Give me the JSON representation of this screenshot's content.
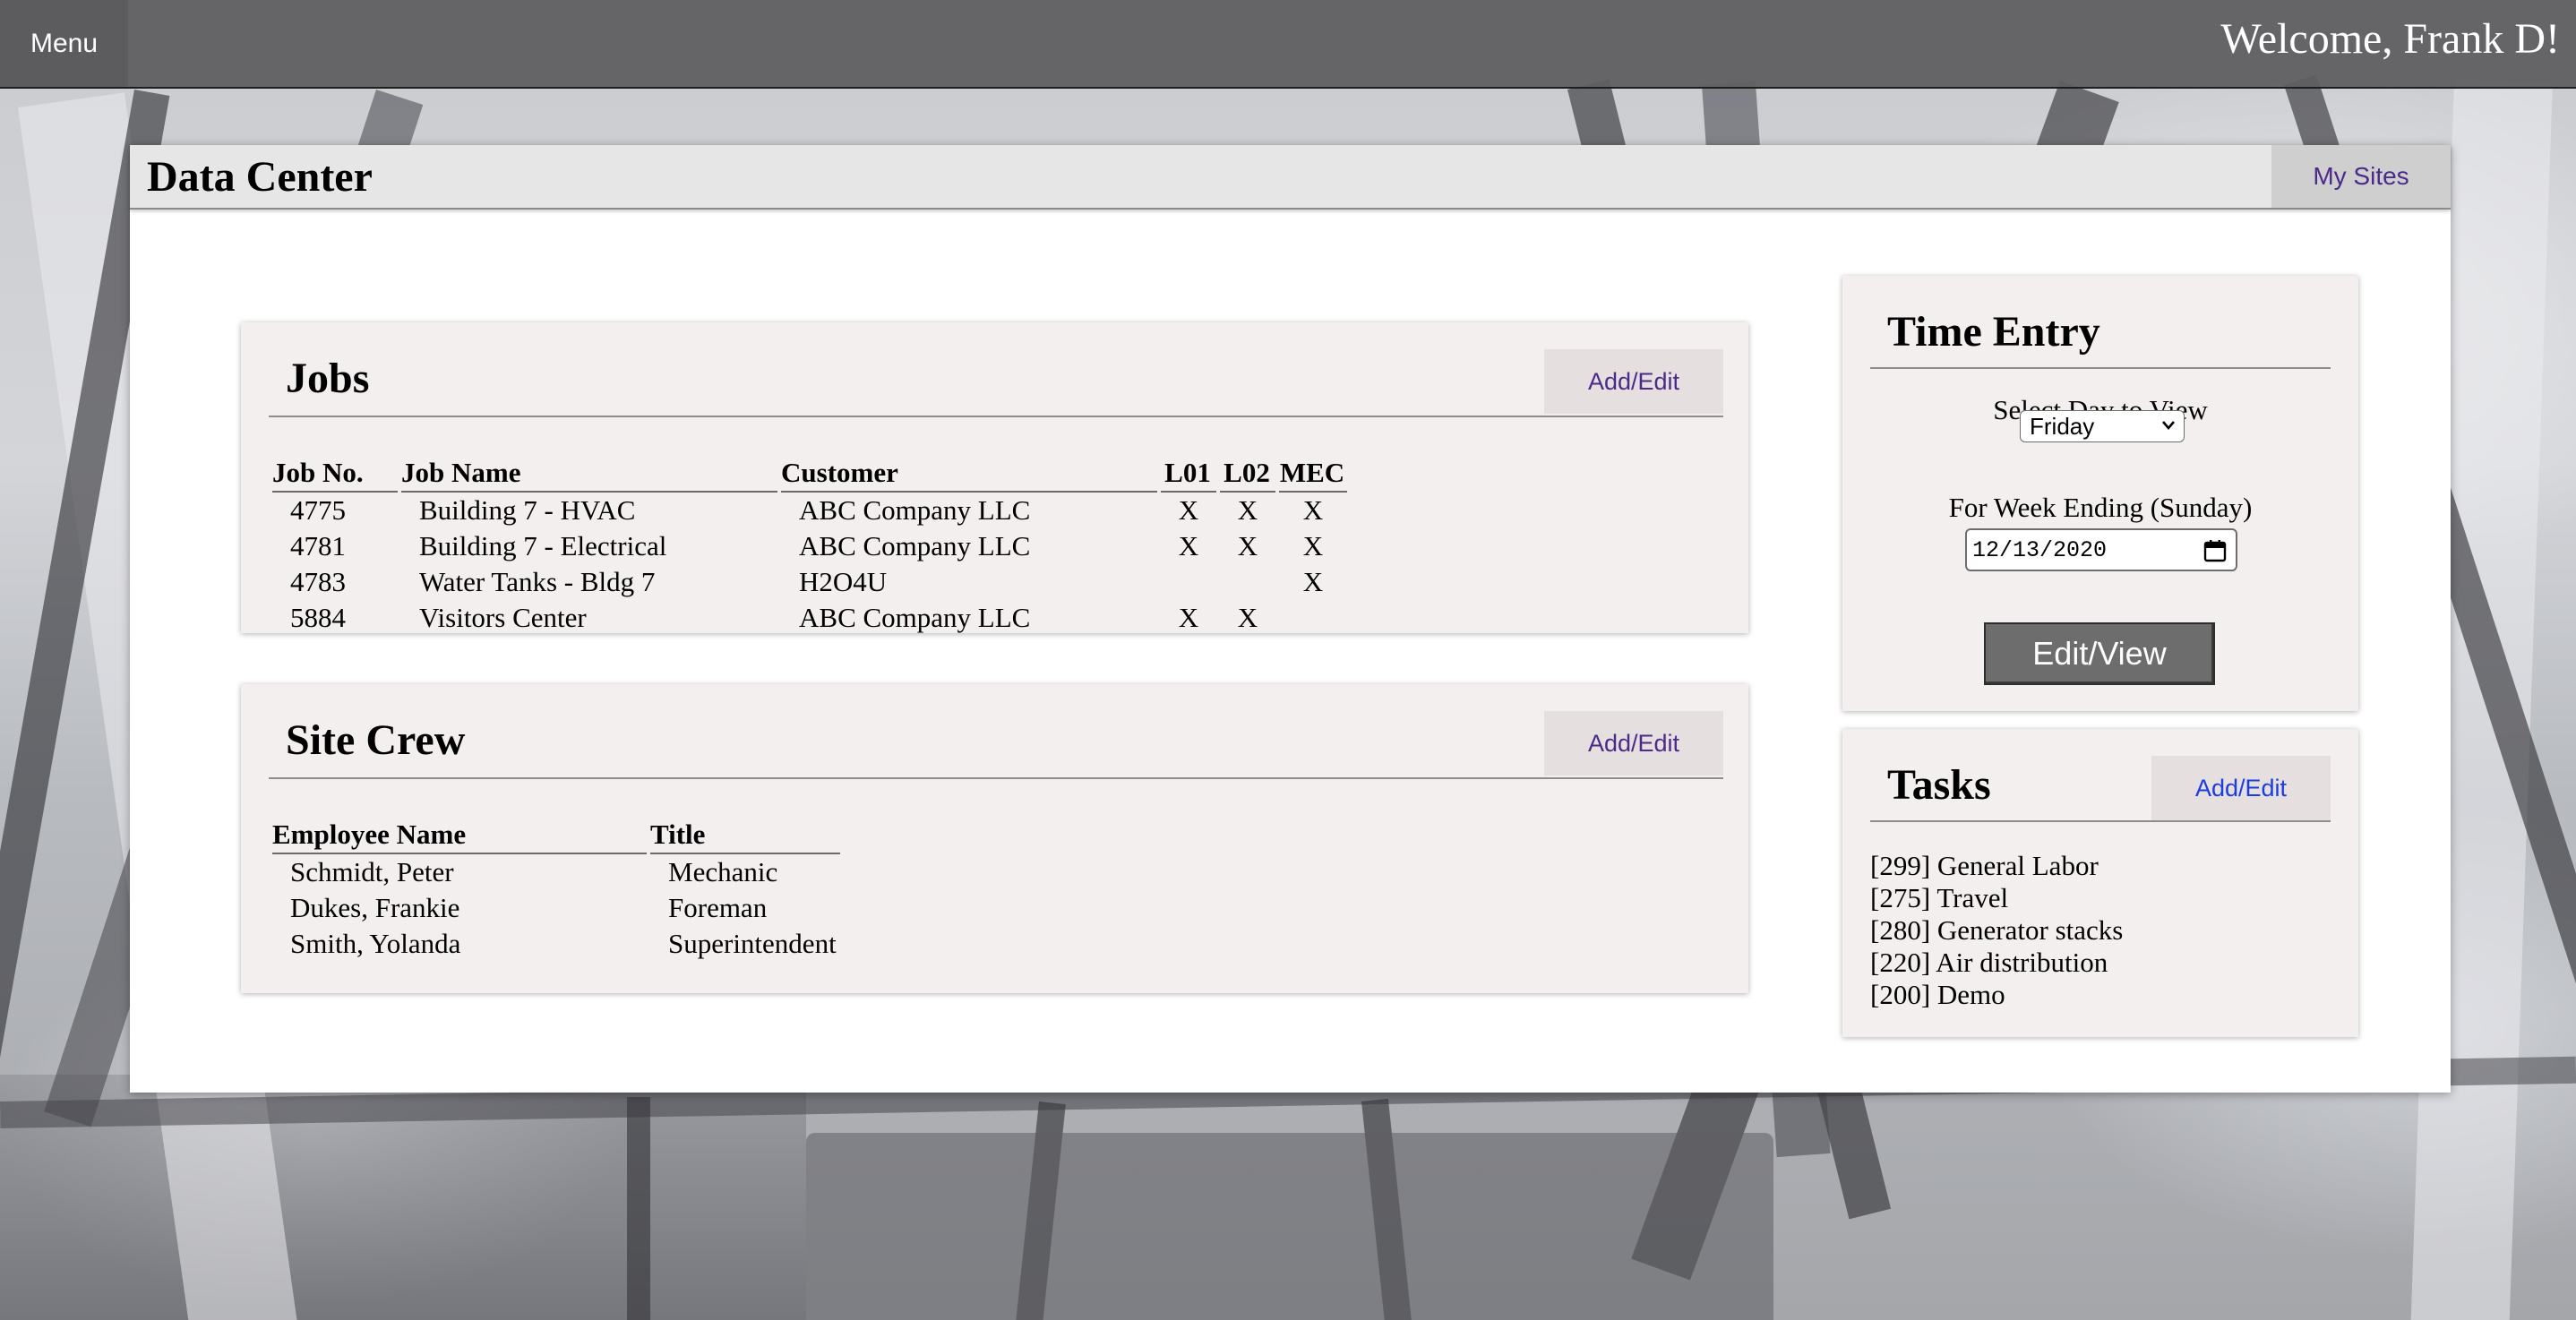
{
  "topbar": {
    "menu_label": "Menu",
    "welcome": "Welcome, Frank D!"
  },
  "header": {
    "title": "Data Center",
    "my_sites": "My Sites"
  },
  "jobs": {
    "title": "Jobs",
    "add_edit": "Add/Edit",
    "columns": [
      "Job No.",
      "Job Name",
      "Customer",
      "L01",
      "L02",
      "MEC"
    ],
    "rows": [
      [
        "4775",
        "Building 7 - HVAC",
        "ABC Company LLC",
        "X",
        "X",
        "X"
      ],
      [
        "4781",
        "Building 7 - Electrical",
        "ABC Company LLC",
        "X",
        "X",
        "X"
      ],
      [
        "4783",
        "Water Tanks - Bldg 7",
        "H2O4U",
        "",
        "",
        "X"
      ],
      [
        "5884",
        "Visitors Center",
        "ABC Company LLC",
        "X",
        "X",
        ""
      ]
    ]
  },
  "crew": {
    "title": "Site Crew",
    "add_edit": "Add/Edit",
    "columns": [
      "Employee Name",
      "Title"
    ],
    "rows": [
      [
        "Schmidt, Peter",
        "Mechanic"
      ],
      [
        "Dukes, Frankie",
        "Foreman"
      ],
      [
        "Smith, Yolanda",
        "Superintendent"
      ]
    ]
  },
  "time_entry": {
    "title": "Time Entry",
    "day_label": "Select Day to View",
    "day_value": "Friday",
    "week_label": "For Week Ending (Sunday)",
    "week_value": "12/13/2020",
    "button": "Edit/View"
  },
  "tasks": {
    "title": "Tasks",
    "add_edit": "Add/Edit",
    "items": [
      "[299] General Labor",
      "[275] Travel",
      "[280] Generator stacks",
      "[220] Air distribution",
      "[200] Demo"
    ]
  },
  "colors": {
    "topbar": "#5f5f61",
    "card_bg": "#f4efef",
    "link_purple": "#4b2a8a",
    "link_blue": "#1b3de0",
    "button_bg": "#6d6d6d"
  }
}
